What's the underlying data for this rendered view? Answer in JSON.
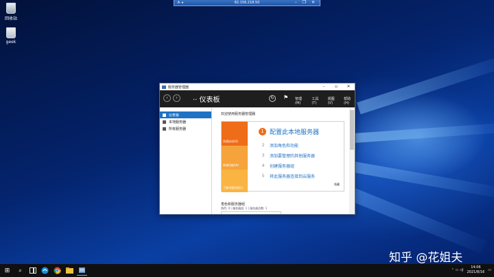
{
  "remote_session": {
    "host": "82.156.218.50",
    "left_label": "ᗑ ◂",
    "right_controls": "– ❐ ✕"
  },
  "desktop": {
    "icons": [
      {
        "label": "回收站",
        "icon": "recycle-bin-icon"
      },
      {
        "label": "geek",
        "icon": "file-icon"
      }
    ]
  },
  "window": {
    "title": "服务器管理器",
    "controls": {
      "minimize": "–",
      "maximize": "▫",
      "close": "✕"
    },
    "toolbar": {
      "back": "‹",
      "forward": "›",
      "breadcrumb": "·· 仪表板",
      "menus": [
        "管理(M)",
        "工具(T)",
        "视图(V)",
        "帮助(H)"
      ]
    },
    "sidebar": {
      "items": [
        {
          "label": "仪表板",
          "active": true
        },
        {
          "label": "本地服务器",
          "active": false
        },
        {
          "label": "所有服务器",
          "active": false
        }
      ]
    },
    "main": {
      "title": "欢迎使用服务器管理器",
      "quick_start": {
        "segments": [
          "快速启动(Q)",
          "新增功能(W)",
          "了解详细信息(L)"
        ],
        "step1": {
          "num": "1",
          "text": "配置此本地服务器"
        },
        "steps": [
          {
            "num": "2",
            "text": "添加角色和功能"
          },
          {
            "num": "3",
            "text": "添加要管理的其他服务器"
          },
          {
            "num": "4",
            "text": "创建服务器组"
          },
          {
            "num": "5",
            "text": "将此服务器连接到云服务"
          }
        ],
        "hide": "隐藏"
      },
      "roles": {
        "title": "角色和服务器组",
        "subtitle": "角色: 0 | 服务器组: 1 | 服务器总数: 1"
      }
    }
  },
  "watermark": "知乎 @花姐夫",
  "taskbar": {
    "start": "⊞",
    "tray_icons": "⌃ ▭ ◁)",
    "time": "14:06",
    "date": "2021/8/16"
  }
}
